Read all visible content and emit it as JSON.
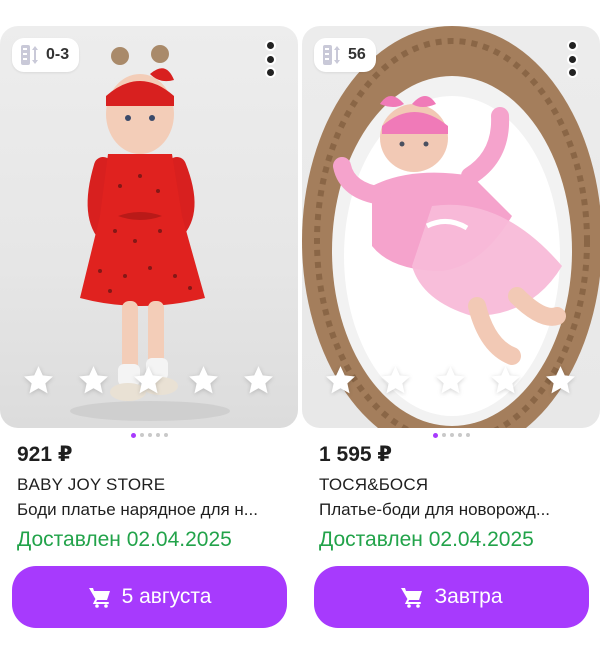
{
  "products": [
    {
      "size_badge": "0-3",
      "price": "921 ₽",
      "brand": "BABY JOY STORE",
      "name": "Боди платье нарядное для н...",
      "delivery": "Доставлен 02.04.2025",
      "button_label": "5 августа",
      "rating_stars": 5,
      "image_position": 1,
      "image_count": 5
    },
    {
      "size_badge": "56",
      "price": "1 595 ₽",
      "brand": "ТОСЯ&БОСЯ",
      "name": "Платье-боди для новорожд...",
      "delivery": "Доставлен 02.04.2025",
      "button_label": "Завтра",
      "rating_stars": 5,
      "image_position": 1,
      "image_count": 5
    }
  ],
  "icons": {
    "size": "size-ruler-icon",
    "more": "more-vertical-icon",
    "star": "star-icon",
    "cart": "cart-icon"
  },
  "colors": {
    "accent": "#a73afd",
    "delivery_green": "#22a34a",
    "text": "#1f1f1f"
  }
}
